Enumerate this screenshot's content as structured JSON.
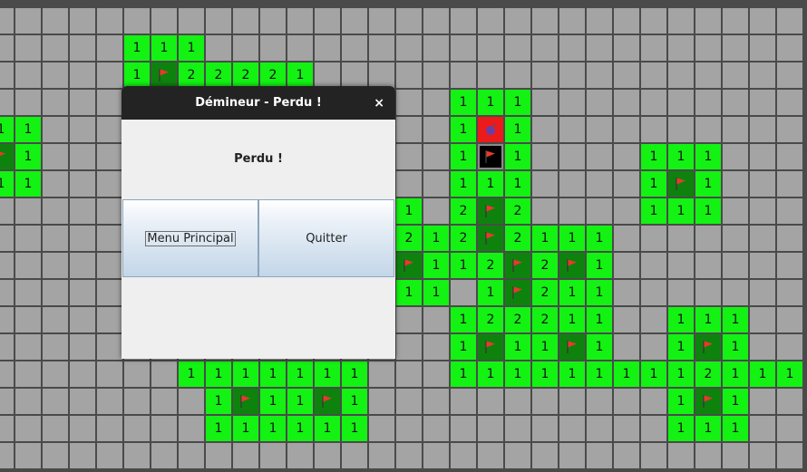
{
  "dialog": {
    "title": "Démineur - Perdu !",
    "close_icon": "×",
    "message": "Perdu !",
    "menu_button": "Menu Principal",
    "quit_button": "Quitter"
  },
  "board": {
    "cols": 30,
    "rows": 17,
    "legend": {
      ".": "hidden",
      "_": "revealed empty",
      "1-8": "revealed number",
      "F": "flag",
      "M": "exploded mine",
      "X": "black marked cell with flag"
    },
    "rows_data": [
      "..............................",
      ".....111......................",
      ".....1F22221..................",
      ".................111..........",
      "11...............1M1..........",
      "F1...............1X1....111...",
      "11...............111....1F1...",
      "..............11.2F2....111...",
      "..............F212F2111.......",
      "..............2F112F2F1.......",
      "..............111.1F211.......",
      ".................122211..111..",
      ".................1F11F1..1F1..",
      ".......1111111...1111111112111",
      "........1F11F1...........1F1...",
      "........111111...........111..",
      ".............................."
    ],
    "colors": {
      "hidden": "#a4a4a4",
      "revealed": "#13f213",
      "flag_cell": "#0d830d",
      "mine_cell": "#ea1b1b",
      "grid": "#4a4a4a"
    }
  }
}
